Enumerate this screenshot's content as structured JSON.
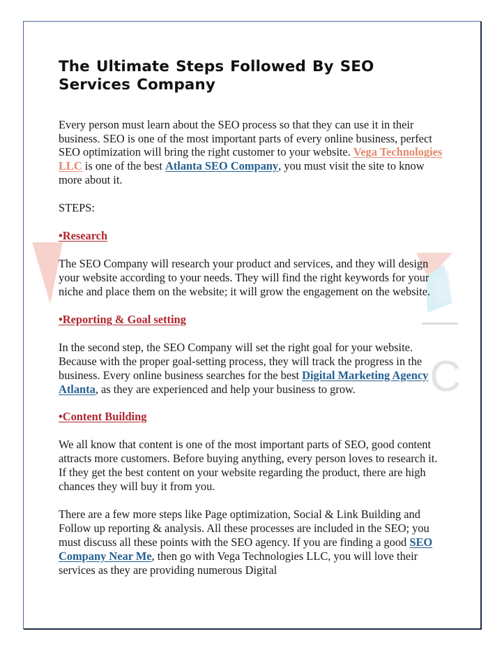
{
  "document": {
    "title": "The Ultimate Steps Followed By SEO Services Company",
    "steps_label": "STEPS:",
    "watermark_letter": "C"
  },
  "colors": {
    "frame_border": "#4e6f95",
    "frame_shadow": "#1c2a40",
    "heading_text": "#111111",
    "body_text": "#1a1a1a",
    "bullet_heading": "#b02630",
    "link_orange": "#e4886b",
    "link_blue": "#245f91",
    "watermark_pink": "#f6cfc9",
    "watermark_blue": "#bfe4f0",
    "watermark_gray": "#e3e3e3"
  },
  "intro": {
    "part1": "Every person must learn about the SEO process so that they can use it in their business. SEO is one of the most important parts of every online business, perfect SEO optimization will bring the right customer to your website. ",
    "link1": "Vega Technologies LLC",
    "part2": " is one of the best ",
    "link2": "Atlanta SEO Company",
    "part3": ", you must visit the site to know more about it."
  },
  "sections": [
    {
      "heading": "•Research",
      "body": "The SEO Company will research your product and services, and they will design your website according to your needs. They will find the right keywords for your niche and place them on the website; it will grow the engagement on the website."
    },
    {
      "heading": "•Reporting & Goal setting",
      "body_part1": "In the second step, the SEO Company will set the right goal for your website. Because with the proper goal-setting process, they will track the progress in the business. Every online business searches for the best ",
      "body_link": "Digital Marketing Agency Atlanta",
      "body_part2": ", as they are experienced and help your business to grow."
    },
    {
      "heading": "•Content Building",
      "body": "We all know that content is one of the most important parts of SEO, good content attracts more customers. Before buying anything, every person loves to research it. If they get the best content on your website regarding the product, there are high chances they will buy it from you."
    }
  ],
  "closing": {
    "part1": "There are a few more steps like Page optimization, Social & Link Building and Follow up reporting & analysis. All these processes are included in the SEO; you must discuss all these points with the SEO agency. If you are finding a good ",
    "link": "SEO Company Near Me",
    "part2": ", then go with Vega Technologies LLC, you will love their services as they are providing numerous Digital"
  }
}
